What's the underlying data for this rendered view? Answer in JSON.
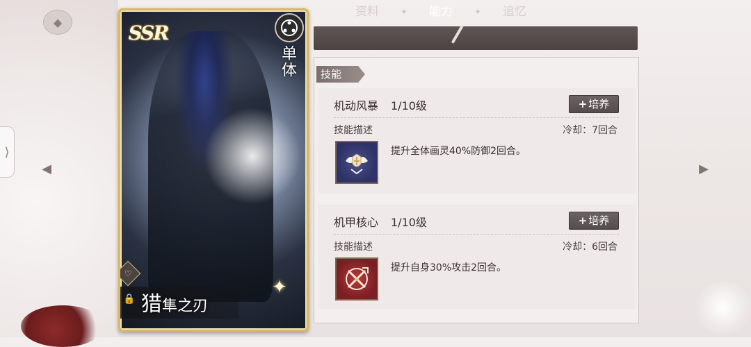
{
  "tabs": {
    "items": [
      "资料",
      "能力",
      "追忆"
    ],
    "active": "能力"
  },
  "card": {
    "rarity": "SSR",
    "scope": "单体",
    "name_main": "猎",
    "name_rest": "隼之刃"
  },
  "section": {
    "title": "技能"
  },
  "skills": [
    {
      "name": "机动风暴",
      "level": "1/10级",
      "train_label": "培养",
      "desc_label": "技能描述",
      "cooldown": "冷却：7回合",
      "description": "提升全体画灵40%防御2回合。",
      "icon": "shield-wings-icon"
    },
    {
      "name": "机甲核心",
      "level": "1/10级",
      "train_label": "培养",
      "desc_label": "技能描述",
      "cooldown": "冷却：6回合",
      "description": "提升自身30%攻击2回合。",
      "icon": "crossed-weapons-icon"
    }
  ],
  "colors": {
    "tab_bg": "#4c4443",
    "card_border": "#d8b860",
    "panel_bg": "#f3efee",
    "button_bg": "#5e5554"
  }
}
